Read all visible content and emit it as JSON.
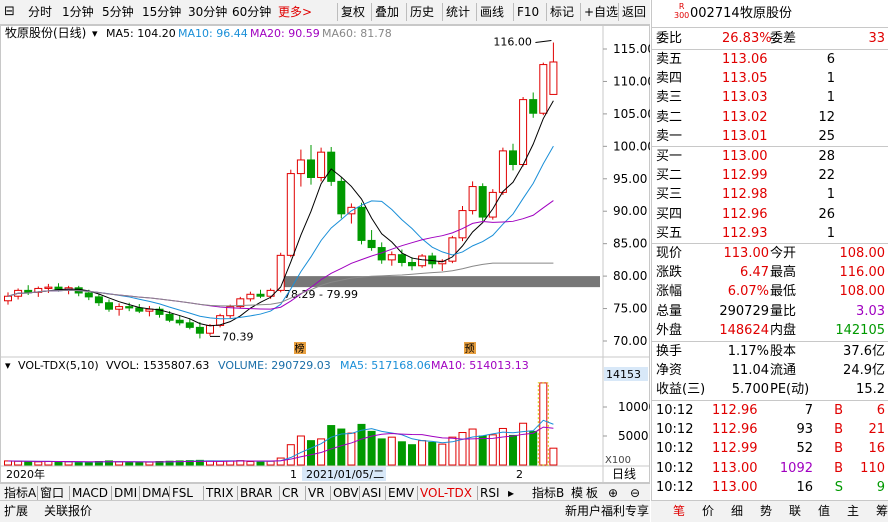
{
  "toolbar": {
    "left_items": [
      "分时",
      "1分钟",
      "5分钟",
      "15分钟",
      "30分钟",
      "60分钟"
    ],
    "more": "更多>",
    "right_items": [
      "复权",
      "叠加",
      "历史",
      "统计",
      "画线",
      "F10",
      "标记",
      "+自选",
      "返回"
    ]
  },
  "stock": {
    "code": "002714",
    "name": "牧原股份",
    "badge_top": "R",
    "badge_bottom": "300"
  },
  "price_chart": {
    "title": "牧原股份(日线)",
    "ma_legend": [
      {
        "label": "MA5: 104.20",
        "color": "#000000"
      },
      {
        "label": "MA10: 96.44",
        "color": "#1a8fd8"
      },
      {
        "label": "MA20: 90.59",
        "color": "#a000c0"
      },
      {
        "label": "MA60: 81.78",
        "color": "#888888"
      }
    ],
    "y_ticks": [
      "115.00",
      "110.00",
      "105.00",
      "100.00",
      "95.00",
      "90.00",
      "85.00",
      "80.00",
      "75.00",
      "70.00"
    ],
    "high_label": "116.00",
    "low_label": "70.39",
    "range_label": "78.29 - 79.99",
    "marker_1": "榜",
    "marker_2": "预"
  },
  "volume_chart": {
    "legend": [
      {
        "label": "VOL-TDX(5,10)",
        "color": "#000000"
      },
      {
        "label": "VVOL: 1535807.63",
        "color": "#000000"
      },
      {
        "label": "VOLUME: 290729.03",
        "color": "#1a6ea8"
      },
      {
        "label": "MA5: 517168.06",
        "color": "#1a8fd8"
      },
      {
        "label": "MA10: 514013.13",
        "color": "#a000c0"
      }
    ],
    "y_ticks": [
      "10000",
      "5000"
    ],
    "current_label": "14153",
    "unit_label": "X100"
  },
  "xaxis": {
    "year_label": "2020年",
    "month_1": "1",
    "date_label": "2021/01/05/二",
    "month_2": "2",
    "period": "日线"
  },
  "indicator_tabs": [
    "指标A",
    "窗口",
    "MACD",
    "DMI",
    "DMA",
    "FSL",
    "TRIX",
    "BRAR",
    "CR",
    "VR",
    "OBV",
    "ASI",
    "EMV",
    "VOL-TDX",
    "RSI"
  ],
  "indicator_active": "VOL-TDX",
  "indicator_right": [
    "指标B",
    "模",
    "板"
  ],
  "bottom_bar": {
    "left": [
      "扩展",
      "关联报价"
    ],
    "right": "新用户福利专享"
  },
  "quote": {
    "weibi_label": "委比",
    "weibi": "26.83%",
    "weicha_label": "委差",
    "weicha": "33",
    "sell": [
      {
        "label": "卖五",
        "price": "113.06",
        "vol": "6"
      },
      {
        "label": "卖四",
        "price": "113.05",
        "vol": "1"
      },
      {
        "label": "卖三",
        "price": "113.03",
        "vol": "1"
      },
      {
        "label": "卖二",
        "price": "113.02",
        "vol": "12"
      },
      {
        "label": "卖一",
        "price": "113.01",
        "vol": "25"
      }
    ],
    "buy": [
      {
        "label": "买一",
        "price": "113.00",
        "vol": "28"
      },
      {
        "label": "买二",
        "price": "112.99",
        "vol": "22"
      },
      {
        "label": "买三",
        "price": "112.98",
        "vol": "1"
      },
      {
        "label": "买四",
        "price": "112.96",
        "vol": "26"
      },
      {
        "label": "买五",
        "price": "112.93",
        "vol": "1"
      }
    ],
    "stats": [
      {
        "l1": "现价",
        "v1": "113.00",
        "c1": "red",
        "l2": "今开",
        "v2": "108.00",
        "c2": "red"
      },
      {
        "l1": "涨跌",
        "v1": "6.47",
        "c1": "red",
        "l2": "最高",
        "v2": "116.00",
        "c2": "red"
      },
      {
        "l1": "涨幅",
        "v1": "6.07%",
        "c1": "red",
        "l2": "最低",
        "v2": "108.00",
        "c2": "red"
      },
      {
        "l1": "总量",
        "v1": "290729",
        "c1": "black",
        "l2": "量比",
        "v2": "3.03",
        "c2": "purple"
      },
      {
        "l1": "外盘",
        "v1": "148624",
        "c1": "red",
        "l2": "内盘",
        "v2": "142105",
        "c2": "green"
      }
    ],
    "fund": [
      {
        "l1": "换手",
        "v1": "1.17%",
        "l2": "股本",
        "v2": "37.6亿"
      },
      {
        "l1": "净资",
        "v1": "11.04",
        "l2": "流通",
        "v2": "24.9亿"
      },
      {
        "l1": "收益(三)",
        "v1": "5.700",
        "l2": "PE(动)",
        "v2": "15.2"
      }
    ],
    "ticks": [
      {
        "time": "10:12",
        "price": "112.96",
        "vol": "7",
        "vol_color": "black",
        "side": "B",
        "side_color": "red",
        "count": "6"
      },
      {
        "time": "10:12",
        "price": "112.96",
        "vol": "93",
        "vol_color": "black",
        "side": "B",
        "side_color": "red",
        "count": "21"
      },
      {
        "time": "10:12",
        "price": "112.99",
        "vol": "52",
        "vol_color": "black",
        "side": "B",
        "side_color": "red",
        "count": "16"
      },
      {
        "time": "10:12",
        "price": "113.00",
        "vol": "1092",
        "vol_color": "purple",
        "side": "B",
        "side_color": "red",
        "count": "110"
      },
      {
        "time": "10:12",
        "price": "113.00",
        "vol": "16",
        "vol_color": "black",
        "side": "S",
        "side_color": "green",
        "count": "9"
      }
    ]
  },
  "right_tabs": [
    "笔",
    "价",
    "细",
    "势",
    "联",
    "值",
    "主",
    "筹"
  ],
  "chart_data": {
    "type": "candlestick",
    "title": "牧原股份(日线)",
    "ylim": [
      68,
      118
    ],
    "candles": [
      [
        76.2,
        77.5,
        75.6,
        76.9
      ],
      [
        76.9,
        78.1,
        76.4,
        77.8
      ],
      [
        77.8,
        78.6,
        77.1,
        77.5
      ],
      [
        77.5,
        78.4,
        76.8,
        78.1
      ],
      [
        78.1,
        78.8,
        77.4,
        78.3
      ],
      [
        78.3,
        78.9,
        77.6,
        77.9
      ],
      [
        77.9,
        78.5,
        77.2,
        78.2
      ],
      [
        78.2,
        78.5,
        76.9,
        77.4
      ],
      [
        77.4,
        77.9,
        76.3,
        76.8
      ],
      [
        76.8,
        77.2,
        75.4,
        75.9
      ],
      [
        75.9,
        76.4,
        74.5,
        74.9
      ],
      [
        74.9,
        75.8,
        73.9,
        75.3
      ],
      [
        75.3,
        75.9,
        74.6,
        75.1
      ],
      [
        75.1,
        75.7,
        74.3,
        74.6
      ],
      [
        74.6,
        75.4,
        73.8,
        74.9
      ],
      [
        74.9,
        75.3,
        73.6,
        74.1
      ],
      [
        74.1,
        74.6,
        72.9,
        73.2
      ],
      [
        73.2,
        73.9,
        72.4,
        72.8
      ],
      [
        72.8,
        73.5,
        71.8,
        72.1
      ],
      [
        72.1,
        72.9,
        70.4,
        71.2
      ],
      [
        71.2,
        72.6,
        70.8,
        72.4
      ],
      [
        72.4,
        74.2,
        72.1,
        73.9
      ],
      [
        73.9,
        75.6,
        73.5,
        75.3
      ],
      [
        75.3,
        76.8,
        75.0,
        76.5
      ],
      [
        76.5,
        77.6,
        76.1,
        77.2
      ],
      [
        77.2,
        77.9,
        76.6,
        76.9
      ],
      [
        76.9,
        78.1,
        76.5,
        77.8
      ],
      [
        77.8,
        83.6,
        77.5,
        83.2
      ],
      [
        83.2,
        96.4,
        82.9,
        95.8
      ],
      [
        95.8,
        99.5,
        93.8,
        97.9
      ],
      [
        97.9,
        100.2,
        94.1,
        95.2
      ],
      [
        95.2,
        99.8,
        94.6,
        99.1
      ],
      [
        99.1,
        99.9,
        93.9,
        94.6
      ],
      [
        94.6,
        95.2,
        88.9,
        89.6
      ],
      [
        89.6,
        91.2,
        88.1,
        90.6
      ],
      [
        90.6,
        91.3,
        84.9,
        85.5
      ],
      [
        85.5,
        87.1,
        83.9,
        84.4
      ],
      [
        84.4,
        85.2,
        81.9,
        82.5
      ],
      [
        82.5,
        83.8,
        81.6,
        83.3
      ],
      [
        83.3,
        84.1,
        81.5,
        82.1
      ],
      [
        82.1,
        82.9,
        80.9,
        81.6
      ],
      [
        81.6,
        83.4,
        81.3,
        83.1
      ],
      [
        83.1,
        83.6,
        81.2,
        81.9
      ],
      [
        81.9,
        82.6,
        80.8,
        82.3
      ],
      [
        82.3,
        86.2,
        82.0,
        85.9
      ],
      [
        85.9,
        90.8,
        85.4,
        90.1
      ],
      [
        90.1,
        94.6,
        89.5,
        93.8
      ],
      [
        93.8,
        94.3,
        88.5,
        89.1
      ],
      [
        89.1,
        93.4,
        88.7,
        92.9
      ],
      [
        92.9,
        99.8,
        92.5,
        99.3
      ],
      [
        99.3,
        100.4,
        96.3,
        97.2
      ],
      [
        97.2,
        107.6,
        96.9,
        107.2
      ],
      [
        107.2,
        108.3,
        104.4,
        105.1
      ],
      [
        105.1,
        112.9,
        104.8,
        112.6
      ],
      [
        108.0,
        116.0,
        108.0,
        113.0
      ]
    ],
    "volume": [
      700,
      650,
      600,
      550,
      600,
      500,
      550,
      450,
      500,
      600,
      700,
      550,
      500,
      450,
      500,
      600,
      650,
      700,
      750,
      800,
      700,
      650,
      700,
      750,
      600,
      500,
      650,
      1200,
      3500,
      5000,
      4200,
      4500,
      6800,
      6200,
      5500,
      7000,
      5800,
      4500,
      4800,
      4000,
      3500,
      4200,
      3900,
      3600,
      4800,
      5600,
      6200,
      5000,
      5200,
      6300,
      5100,
      7200,
      5800,
      14153,
      2900
    ]
  }
}
